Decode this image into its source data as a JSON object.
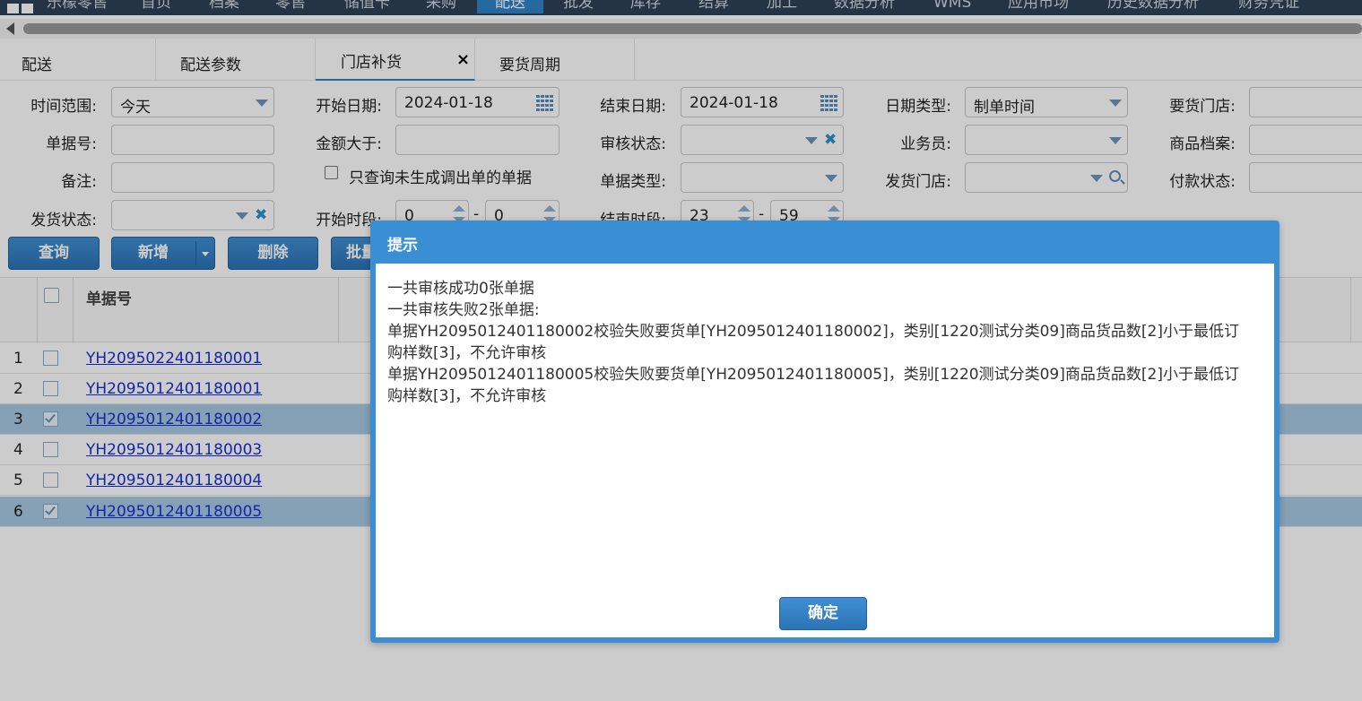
{
  "nav": {
    "items": [
      "乐檬零售",
      "首页",
      "档案",
      "零售",
      "储值卡",
      "采购",
      "配送",
      "批发",
      "库存",
      "结算",
      "加工",
      "数据分析",
      "WMS",
      "应用市场",
      "历史数据分析",
      "财务凭证"
    ],
    "active": "配送"
  },
  "tabs": [
    {
      "label": "配送"
    },
    {
      "label": "配送参数"
    },
    {
      "label": "门店补货",
      "close": "×"
    },
    {
      "label": "要货周期"
    }
  ],
  "form": {
    "time_range_label": "时间范围:",
    "time_range_value": "今天",
    "start_date_label": "开始日期:",
    "start_date_value": "2024-01-18",
    "end_date_label": "结束日期:",
    "end_date_value": "2024-01-18",
    "date_type_label": "日期类型:",
    "date_type_value": "制单时间",
    "request_store_label": "要货门店:",
    "doc_no_label": "单据号:",
    "amount_gt_label": "金额大于:",
    "audit_status_label": "审核状态:",
    "salesman_label": "业务员:",
    "product_file_label": "商品档案:",
    "remark_label": "备注:",
    "only_query_label": "只查询未生成调出单的单据",
    "doc_type_label": "单据类型:",
    "ship_store_label": "发货门店:",
    "pay_status_label": "付款状态:",
    "ship_status_label": "发货状态:",
    "start_period_label": "开始时段:",
    "start_period_from": "0",
    "start_period_to": "0",
    "end_period_label": "结束时段:",
    "end_period_from": "23",
    "end_period_to": "59",
    "dash": "-",
    "clear_glyph": "✖"
  },
  "buttons": {
    "query": "查询",
    "add": "新增",
    "delete": "删除",
    "batch": "批量"
  },
  "grid": {
    "col_doc_no": "单据号",
    "rows": [
      {
        "num": "1",
        "doc": "YH2095022401180001",
        "checked": false
      },
      {
        "num": "2",
        "doc": "YH2095012401180001",
        "checked": false
      },
      {
        "num": "3",
        "doc": "YH2095012401180002",
        "checked": true
      },
      {
        "num": "4",
        "doc": "YH2095012401180003",
        "checked": false
      },
      {
        "num": "5",
        "doc": "YH2095012401180004",
        "checked": false
      },
      {
        "num": "6",
        "doc": "YH2095012401180005",
        "checked": true
      }
    ]
  },
  "dialog": {
    "title": "提示",
    "line1": "一共审核成功0张单据",
    "line2": "一共审核失败2张单据:",
    "line3": "单据YH2095012401180002校验失败要货单[YH2095012401180002]，类别[1220测试分类09]商品货品数[2]小于最低订购样数[3]，不允许审核",
    "line4": "单据YH2095012401180005校验失败要货单[YH2095012401180005]，类别[1220测试分类09]商品货品数[2]小于最低订购样数[3]，不允许审核",
    "ok": "确定"
  }
}
